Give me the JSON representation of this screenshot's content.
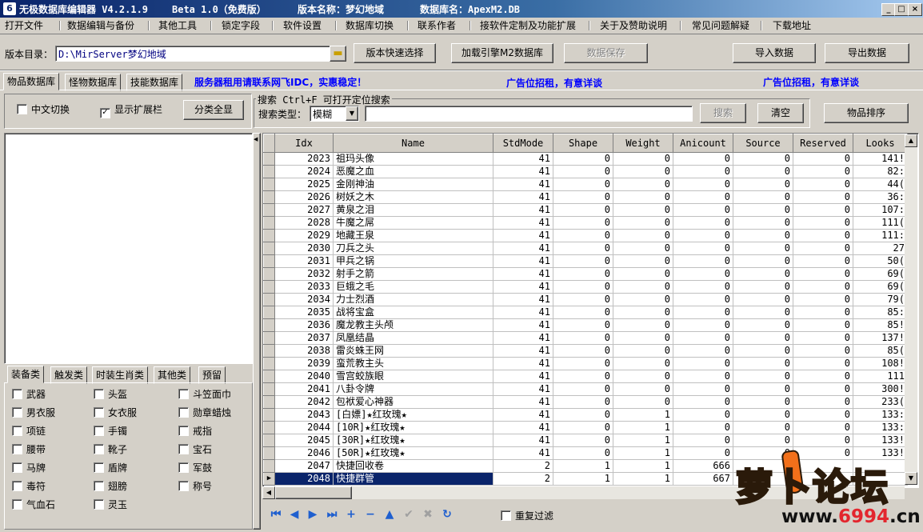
{
  "window": {
    "title_app": "无极数据库编辑器 V4.2.1.9",
    "title_beta": "Beta 1.0（免费版）",
    "title_version": "版本名称：梦幻地域",
    "title_db": "数据库名：ApexM2.DB"
  },
  "menu": [
    "打开文件",
    "数据编辑与备份",
    "其他工具",
    "锁定字段",
    "软件设置",
    "数据库切换",
    "联系作者",
    "接软件定制及功能扩展",
    "关于及赞助说明",
    "常见问题解疑",
    "下载地址"
  ],
  "toolbar": {
    "dir_label": "版本目录：",
    "dir_value": "D:\\MirServer梦幻地域",
    "quick_select": "版本快速选择",
    "load_db": "加载引擎M2数据库",
    "save_data": "数据保存",
    "import_data": "导入数据",
    "export_data": "导出数据"
  },
  "tabs": {
    "main": [
      "物品数据库",
      "怪物数据库",
      "技能数据库"
    ],
    "promo1": "服务器租用请联系网飞IDC，实惠稳定！",
    "promo2": "广告位招租，有意详谈",
    "promo3": "广告位招租，有意详谈"
  },
  "options": {
    "cn_switch": "中文切换",
    "show_ext": "显示扩展栏",
    "show_all": "分类全显"
  },
  "search": {
    "group_label": "搜索   Ctrl+F 可打开定位搜索",
    "type_label": "搜索类型：",
    "type_value": "模糊",
    "search_btn": "搜索",
    "clear_btn": "清空",
    "sort_btn": "物品排序"
  },
  "category_tabs": [
    "装备类",
    "触发类",
    "时装生肖类",
    "其他类",
    "预留"
  ],
  "categories": [
    [
      "武器",
      "头盔",
      "斗笠面巾"
    ],
    [
      "男衣服",
      "女衣服",
      "勋章蜡烛"
    ],
    [
      "项链",
      "手镯",
      "戒指"
    ],
    [
      "腰带",
      "靴子",
      "宝石"
    ],
    [
      "马牌",
      "盾牌",
      "军鼓"
    ],
    [
      "毒符",
      "翅膀",
      "称号"
    ],
    [
      "气血石",
      "灵玉",
      ""
    ]
  ],
  "grid": {
    "columns": [
      "Idx",
      "Name",
      "StdMode",
      "Shape",
      "Weight",
      "Anicount",
      "Source",
      "Reserved",
      "Looks"
    ],
    "rows": [
      [
        "2023",
        "祖玛头像",
        "41",
        "0",
        "0",
        "0",
        "0",
        "0",
        "141!"
      ],
      [
        "2024",
        "恶魔之血",
        "41",
        "0",
        "0",
        "0",
        "0",
        "0",
        "82:"
      ],
      [
        "2025",
        "金刚神油",
        "41",
        "0",
        "0",
        "0",
        "0",
        "0",
        "44("
      ],
      [
        "2026",
        "树妖之木",
        "41",
        "0",
        "0",
        "0",
        "0",
        "0",
        "36:"
      ],
      [
        "2027",
        "黄泉之泪",
        "41",
        "0",
        "0",
        "0",
        "0",
        "0",
        "107:"
      ],
      [
        "2028",
        "牛魔之屌",
        "41",
        "0",
        "0",
        "0",
        "0",
        "0",
        "111("
      ],
      [
        "2029",
        "地藏王泉",
        "41",
        "0",
        "0",
        "0",
        "0",
        "0",
        "111:"
      ],
      [
        "2030",
        "刀兵之头",
        "41",
        "0",
        "0",
        "0",
        "0",
        "0",
        "27"
      ],
      [
        "2031",
        "甲兵之锅",
        "41",
        "0",
        "0",
        "0",
        "0",
        "0",
        "50("
      ],
      [
        "2032",
        "射手之箭",
        "41",
        "0",
        "0",
        "0",
        "0",
        "0",
        "69("
      ],
      [
        "2033",
        "巨蛾之毛",
        "41",
        "0",
        "0",
        "0",
        "0",
        "0",
        "69("
      ],
      [
        "2034",
        "力士烈酒",
        "41",
        "0",
        "0",
        "0",
        "0",
        "0",
        "79("
      ],
      [
        "2035",
        "战将宝盒",
        "41",
        "0",
        "0",
        "0",
        "0",
        "0",
        "85:"
      ],
      [
        "2036",
        "魔龙教主头颅",
        "41",
        "0",
        "0",
        "0",
        "0",
        "0",
        "85!"
      ],
      [
        "2037",
        "凤凰结晶",
        "41",
        "0",
        "0",
        "0",
        "0",
        "0",
        "137!"
      ],
      [
        "2038",
        "雷炎蛛王网",
        "41",
        "0",
        "0",
        "0",
        "0",
        "0",
        "85("
      ],
      [
        "2039",
        "蛮荒教主头",
        "41",
        "0",
        "0",
        "0",
        "0",
        "0",
        "108!"
      ],
      [
        "2040",
        "雪宫蛟族眼",
        "41",
        "0",
        "0",
        "0",
        "0",
        "0",
        "111"
      ],
      [
        "2041",
        "八卦令牌",
        "41",
        "0",
        "0",
        "0",
        "0",
        "0",
        "300!"
      ],
      [
        "2042",
        "包袱爱心神器",
        "41",
        "0",
        "0",
        "0",
        "0",
        "0",
        "233("
      ],
      [
        "2043",
        "[白嫖]★红玫瑰★",
        "41",
        "0",
        "1",
        "0",
        "0",
        "0",
        "133:"
      ],
      [
        "2044",
        "[10R]★红玫瑰★",
        "41",
        "0",
        "1",
        "0",
        "0",
        "0",
        "133:"
      ],
      [
        "2045",
        "[30R]★红玫瑰★",
        "41",
        "0",
        "1",
        "0",
        "0",
        "0",
        "133!"
      ],
      [
        "2046",
        "[50R]★红玫瑰★",
        "41",
        "0",
        "1",
        "0",
        "0",
        "0",
        "133!"
      ],
      [
        "2047",
        "快捷回收卷",
        "2",
        "1",
        "1",
        "666",
        "",
        "",
        ""
      ],
      [
        "2048",
        "快捷群管",
        "2",
        "1",
        "1",
        "667",
        "",
        "",
        ""
      ]
    ],
    "selected_index": 25
  },
  "nav": {
    "repeat_filter": "重复过滤"
  },
  "watermark": {
    "logo": "萝卜论坛",
    "url_prefix": "www.",
    "url_mid": "6994",
    "url_suffix": ".cn"
  }
}
